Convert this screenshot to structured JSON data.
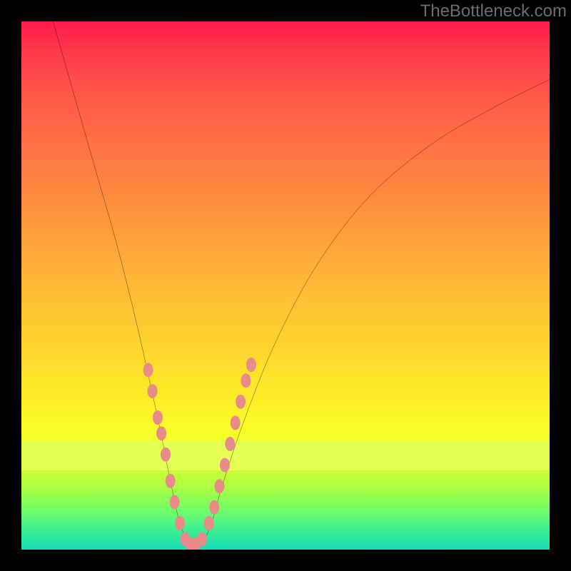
{
  "watermark": "TheBottleneck.com",
  "chart_data": {
    "type": "line",
    "title": "",
    "xlabel": "",
    "ylabel": "",
    "xlim": [
      0,
      100
    ],
    "ylim": [
      0,
      100
    ],
    "curve": {
      "name": "bottleneck-curve",
      "minimum_x": 32,
      "points": [
        {
          "x": 6,
          "y": 100
        },
        {
          "x": 10,
          "y": 86
        },
        {
          "x": 14,
          "y": 72
        },
        {
          "x": 18,
          "y": 58
        },
        {
          "x": 22,
          "y": 42
        },
        {
          "x": 26,
          "y": 24
        },
        {
          "x": 28,
          "y": 14
        },
        {
          "x": 30,
          "y": 5
        },
        {
          "x": 32,
          "y": 1
        },
        {
          "x": 34,
          "y": 1
        },
        {
          "x": 36,
          "y": 5
        },
        {
          "x": 38,
          "y": 12
        },
        {
          "x": 42,
          "y": 24
        },
        {
          "x": 48,
          "y": 39
        },
        {
          "x": 56,
          "y": 54
        },
        {
          "x": 66,
          "y": 67
        },
        {
          "x": 78,
          "y": 77
        },
        {
          "x": 90,
          "y": 84
        },
        {
          "x": 100,
          "y": 89
        }
      ]
    },
    "markers": {
      "name": "sample-nodes",
      "color": "#e98b88",
      "points": [
        {
          "x": 24.0,
          "y": 34
        },
        {
          "x": 24.8,
          "y": 30
        },
        {
          "x": 25.8,
          "y": 25
        },
        {
          "x": 26.5,
          "y": 22
        },
        {
          "x": 27.3,
          "y": 18
        },
        {
          "x": 28.2,
          "y": 13
        },
        {
          "x": 29.0,
          "y": 9
        },
        {
          "x": 30.0,
          "y": 5
        },
        {
          "x": 31.0,
          "y": 2
        },
        {
          "x": 32.0,
          "y": 1
        },
        {
          "x": 33.0,
          "y": 1
        },
        {
          "x": 34.2,
          "y": 2
        },
        {
          "x": 35.5,
          "y": 5
        },
        {
          "x": 36.5,
          "y": 8
        },
        {
          "x": 37.5,
          "y": 12
        },
        {
          "x": 38.5,
          "y": 16
        },
        {
          "x": 39.5,
          "y": 20
        },
        {
          "x": 40.5,
          "y": 24
        },
        {
          "x": 41.5,
          "y": 28
        },
        {
          "x": 42.5,
          "y": 32
        },
        {
          "x": 43.5,
          "y": 35
        }
      ]
    }
  }
}
